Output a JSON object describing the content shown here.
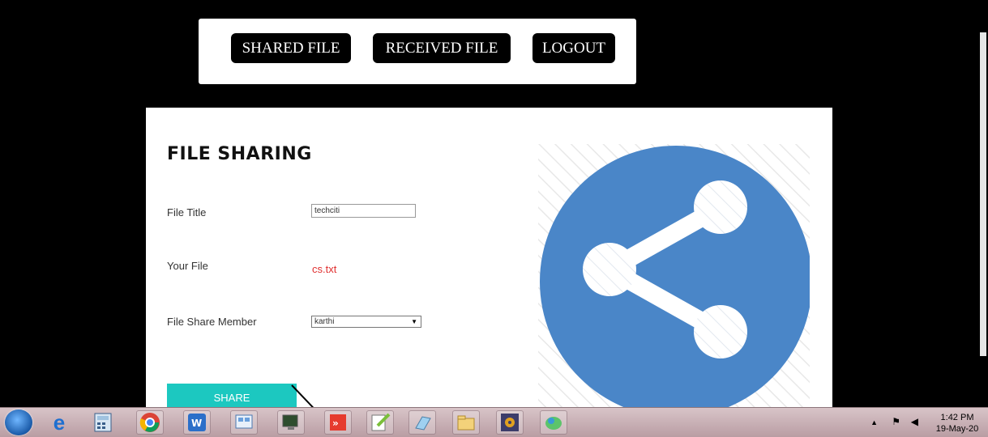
{
  "nav": {
    "shared_file": "SHARED FILE",
    "received_file": "RECEIVED FILE",
    "logout": "LOGOUT"
  },
  "form": {
    "title": "FILE SHARING",
    "file_title_label": "File Title",
    "file_title_value": "techciti",
    "your_file_label": "Your File",
    "your_file_value": "cs.txt",
    "member_label": "File Share Member",
    "member_selected": "karthi",
    "share_button": "SHARE"
  },
  "colors": {
    "accent": "#1cc8c0",
    "share_icon_circle": "#4a86c8",
    "file_name": "#e03030"
  },
  "taskbar": {
    "icons": [
      "windows-start-icon",
      "internet-explorer-icon",
      "calculator-icon",
      "chrome-icon",
      "wps-writer-icon",
      "control-panel-icon",
      "remote-desktop-icon",
      "anydesk-icon",
      "notepad-plus-plus-icon",
      "notepad-icon",
      "file-explorer-icon",
      "app-settings-icon",
      "media-icon"
    ],
    "time": "1:42 PM",
    "date": "19-May-20"
  }
}
